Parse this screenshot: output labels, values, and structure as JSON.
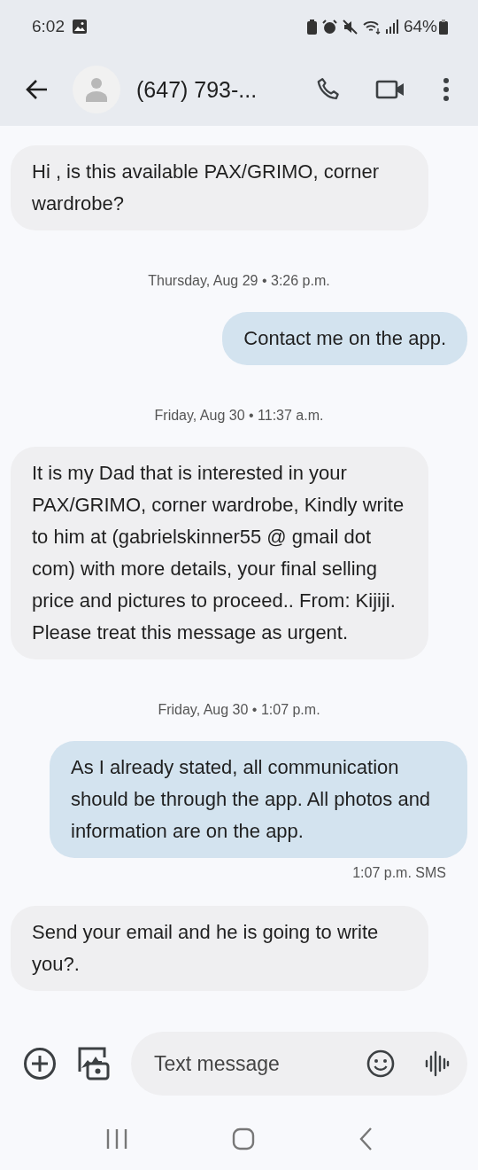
{
  "status_bar": {
    "time": "6:02",
    "battery": "64%"
  },
  "header": {
    "title": "(647) 793-..."
  },
  "messages": [
    {
      "kind": "incoming",
      "text": "Hi , is this available PAX/GRIMO, corner wardrobe?"
    },
    {
      "kind": "date",
      "text": "Thursday, Aug 29 • 3:26 p.m."
    },
    {
      "kind": "outgoing",
      "text": "Contact me on the app."
    },
    {
      "kind": "date",
      "text": "Friday, Aug 30 • 11:37 a.m."
    },
    {
      "kind": "incoming",
      "text": "It is my Dad that is interested in your PAX/GRIMO, corner wardrobe, Kindly write to him at (gabrielskinner55 @ gmail dot com) with more details, your final selling price and pictures to proceed.. From: Kijiji. Please treat this message as urgent."
    },
    {
      "kind": "date",
      "text": "Friday, Aug 30 • 1:07 p.m."
    },
    {
      "kind": "outgoing",
      "text": "As I already stated, all communication should be through the app.  All photos and information are on the app.",
      "meta": "1:07 p.m. SMS"
    },
    {
      "kind": "incoming",
      "text": "Send your email and he is going to write you?."
    }
  ],
  "compose": {
    "placeholder": "Text message"
  }
}
